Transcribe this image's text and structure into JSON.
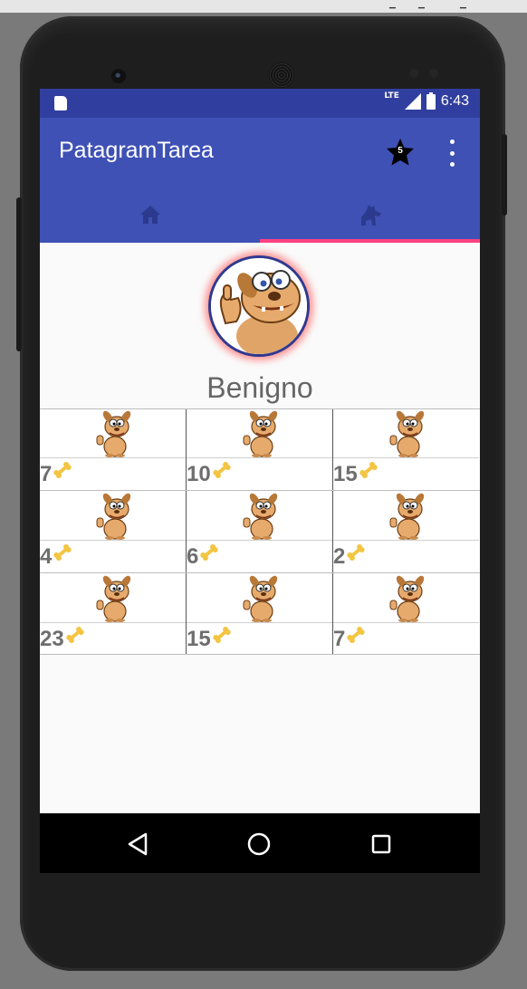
{
  "status_bar": {
    "network": "LTE",
    "time": "6:43"
  },
  "app_bar": {
    "title": "PatagramTarea",
    "rating_count": "5"
  },
  "tabs": [
    {
      "icon": "home-icon",
      "selected": false
    },
    {
      "icon": "dog-icon",
      "selected": true
    }
  ],
  "profile": {
    "name": "Benigno"
  },
  "photo_grid": [
    {
      "likes": "7"
    },
    {
      "likes": "10"
    },
    {
      "likes": "15"
    },
    {
      "likes": "4"
    },
    {
      "likes": "6"
    },
    {
      "likes": "2"
    },
    {
      "likes": "23"
    },
    {
      "likes": "15"
    },
    {
      "likes": "7"
    }
  ],
  "colors": {
    "primary": "#3f51b5",
    "primary_dark": "#303f9f",
    "accent": "#ff4081",
    "bone": "#f4c542"
  }
}
